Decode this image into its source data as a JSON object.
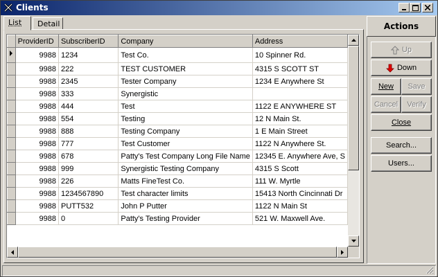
{
  "window": {
    "title": "Clients"
  },
  "tabs": [
    {
      "label": "List",
      "active": true
    },
    {
      "label": "Detail",
      "active": false
    }
  ],
  "grid": {
    "columns": [
      "ProviderID",
      "SubscriberID",
      "Company",
      "Address"
    ],
    "rows": [
      [
        "9988",
        "1234",
        "Test Co.",
        "10 Spinner Rd."
      ],
      [
        "9988",
        "222",
        "TEST CUSTOMER",
        "4315 S SCOTT ST"
      ],
      [
        "9988",
        "2345",
        "Tester Company",
        "1234 E Anywhere St"
      ],
      [
        "9988",
        "333",
        "Synergistic",
        ""
      ],
      [
        "9988",
        "444",
        "Test",
        "1122 E ANYWHERE ST"
      ],
      [
        "9988",
        "554",
        "Testing",
        "12 N Main St."
      ],
      [
        "9988",
        "888",
        "Testing Company",
        "1 E Main Street"
      ],
      [
        "9988",
        "777",
        "Test Customer",
        "1122 N Anywhere St."
      ],
      [
        "9988",
        "678",
        "Patty's Test Company Long File Name",
        "12345 E. Anywhere Ave, S"
      ],
      [
        "9988",
        "999",
        "Synergistic Testing Company",
        "4315 S Scott"
      ],
      [
        "9988",
        "226",
        "Matts FineTest Co.",
        "111 W. Myrtle"
      ],
      [
        "9988",
        "1234567890",
        "Test character limits",
        "15413 North Cincinnati Dr"
      ],
      [
        "9988",
        "PUTT532",
        "John P Putter",
        "1122 N Main St"
      ],
      [
        "9988",
        "0",
        "Patty's Testing Provider",
        "521 W. Maxwell Ave."
      ]
    ],
    "current_row": 0
  },
  "actions": {
    "header": "Actions",
    "up": "Up",
    "down": "Down",
    "new": "New",
    "save": "Save",
    "cancel": "Cancel",
    "verify": "Verify",
    "close": "Close",
    "search": "Search...",
    "users": "Users..."
  }
}
